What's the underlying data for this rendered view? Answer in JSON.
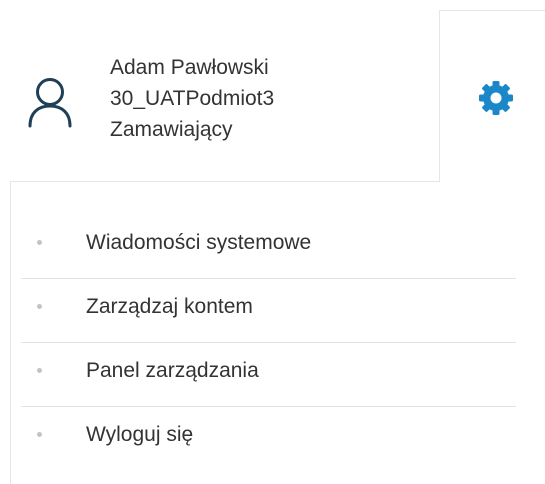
{
  "user": {
    "name": "Adam Pawłowski",
    "organization": "30_UATPodmiot3",
    "role": "Zamawiający",
    "icon": "user-icon"
  },
  "settings": {
    "icon": "gear-icon",
    "color": "#1a87c9"
  },
  "menu": {
    "items": [
      {
        "label": "Wiadomości systemowe"
      },
      {
        "label": "Zarządzaj kontem"
      },
      {
        "label": "Panel zarządzania"
      },
      {
        "label": "Wyloguj się"
      }
    ]
  }
}
